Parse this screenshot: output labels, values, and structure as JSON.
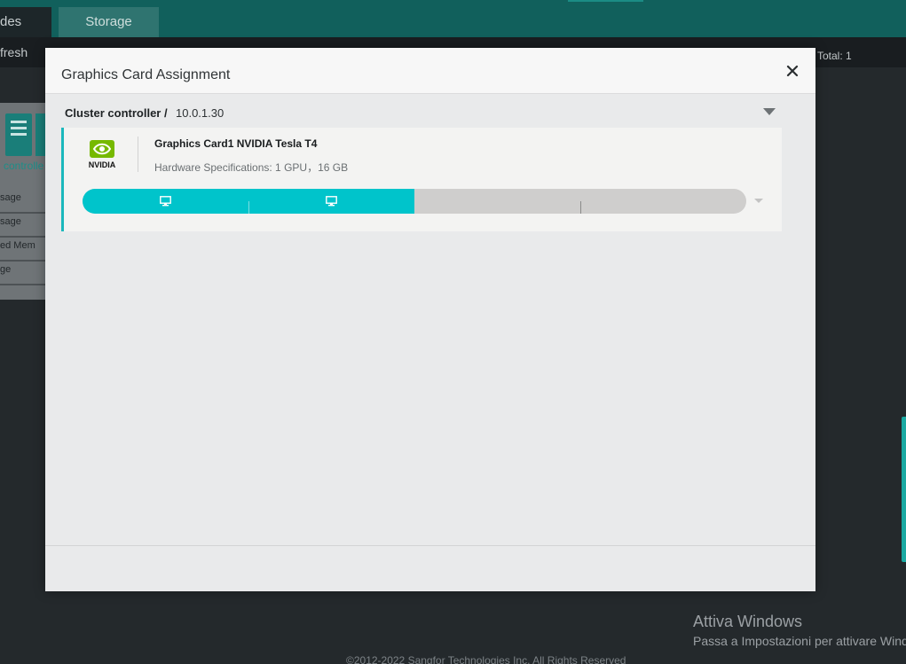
{
  "background": {
    "tabs": [
      {
        "label": "des"
      },
      {
        "label": "Storage"
      }
    ],
    "toolbar": {
      "refresh_label": "fresh",
      "total_label": "Total: 1"
    },
    "node_card": {
      "label": "controlle",
      "metrics": [
        "sage",
        "sage",
        "ed Mem",
        "ge"
      ]
    },
    "footer_copyright": "©2012-2022 Sangfor Technologies Inc. All Rights Reserved",
    "watermark": {
      "title": "Attiva Windows",
      "subtitle": "Passa a Impostazioni per attivare Wind"
    }
  },
  "modal": {
    "title": "Graphics Card Assignment",
    "close_icon": "close-icon",
    "cluster": {
      "label": "Cluster controller /",
      "ip": "10.0.1.30"
    },
    "gpu": {
      "name": "Graphics Card1 NVIDIA Tesla T4",
      "spec": "Hardware Specifications: 1 GPU，16 GB",
      "logo_text": "NVIDIA",
      "allocation": {
        "total_segments": 4,
        "allocated_segments": 2,
        "allocated_fraction": 0.5,
        "segment_icons": [
          "monitor-icon",
          "monitor-icon"
        ]
      }
    }
  },
  "colors": {
    "header_teal": "#11605c",
    "accent_cyan": "#00c4cb",
    "nvidia_green": "#76b900",
    "bar_empty": "#cfcecd"
  }
}
